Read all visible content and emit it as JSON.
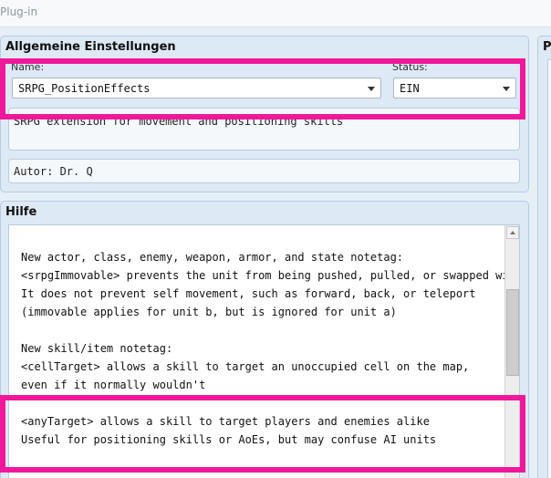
{
  "window": {
    "title": "Plug-in"
  },
  "general": {
    "title": "Allgemeine Einstellungen",
    "name_label": "Name:",
    "name_value": "SRPG_PositionEffects",
    "status_label": "Status:",
    "status_value": "EIN",
    "description": "SRPG extension for movement and positioning skills",
    "author": "Autor: Dr. Q"
  },
  "right_panel": {
    "title": "P"
  },
  "help": {
    "title": "Hilfe",
    "lines": [
      "New actor, class, enemy, weapon, armor, and state notetag:",
      "<srpgImmovable> prevents the unit from being pushed, pulled, or swapped with",
      "It does not prevent self movement, such as forward, back, or teleport",
      "(immovable applies for unit b, but is ignored for unit a)",
      "",
      "New skill/item notetag:",
      "<cellTarget> allows a skill to target an unoccupied cell on the map,",
      "even if it normally wouldn't",
      "",
      "<anyTarget> allows a skill to target players and enemies alike",
      "Useful for positioning skills or AoEs, but may confuse AI units"
    ]
  },
  "colors": {
    "highlight": "#f0189a",
    "panel_bg": "#dde9f5"
  }
}
